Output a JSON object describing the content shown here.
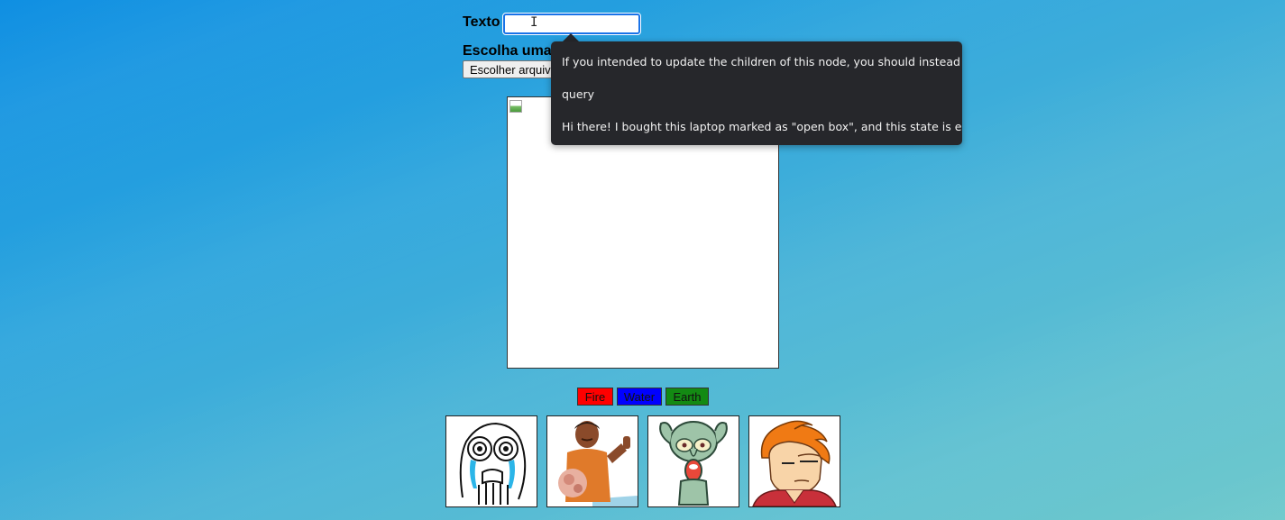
{
  "form": {
    "text_label": "Texto",
    "text_value": "",
    "image_label": "Escolha uma",
    "file_button_label": "Escolher arquiv"
  },
  "tooltip": {
    "lines": [
      "If you intended to update the children of this node, you should instead",
      "query",
      "Hi there!  I bought this laptop marked as \"open box\", and this state is e"
    ]
  },
  "buttons": {
    "fire": "Fire",
    "water": "Water",
    "earth": "Earth"
  },
  "buttons_colors": {
    "fire": "#ff0000",
    "water": "#0000ff",
    "earth": "#138a13"
  },
  "thumbnails": [
    {
      "icon": "crying-rage-face-icon"
    },
    {
      "icon": "thumbs-up-man-icon"
    },
    {
      "icon": "squidward-screaming-icon"
    },
    {
      "icon": "fry-squinting-icon"
    }
  ]
}
